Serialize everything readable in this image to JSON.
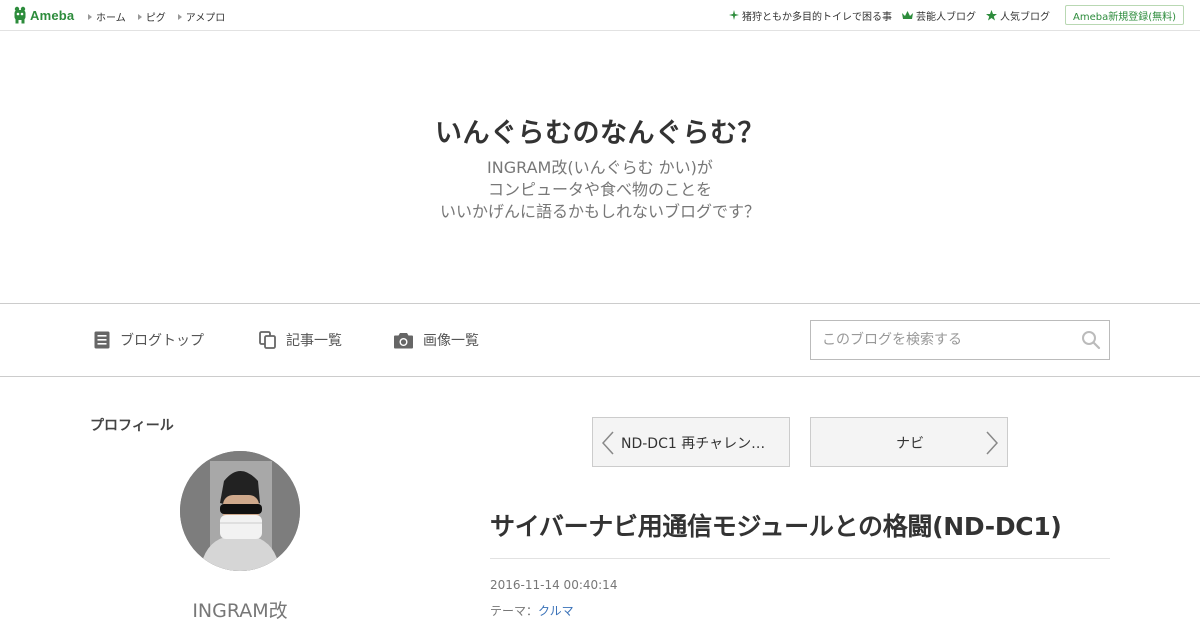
{
  "topbar": {
    "logo_text": "Ameba",
    "nav": [
      {
        "label": "ホーム"
      },
      {
        "label": "ピグ"
      },
      {
        "label": "アメプロ"
      }
    ],
    "right_links": [
      {
        "label": "猪狩ともか多目的トイレで困る事",
        "icon": "sparkle-icon"
      },
      {
        "label": "芸能人ブログ",
        "icon": "crown-icon"
      },
      {
        "label": "人気ブログ",
        "icon": "star-icon"
      }
    ],
    "register_label": "Ameba新規登録(無料)"
  },
  "header": {
    "title": "いんぐらむのなんぐらむ？",
    "description": [
      "INGRAM改(いんぐらむ かい)が",
      "コンピュータや食べ物のことを",
      "いいかげんに語るかもしれないブログです？"
    ]
  },
  "navbar": {
    "items": [
      {
        "label": "ブログトップ",
        "icon": "document-icon"
      },
      {
        "label": "記事一覧",
        "icon": "copy-icon"
      },
      {
        "label": "画像一覧",
        "icon": "camera-icon"
      }
    ],
    "search_placeholder": "このブログを検索する"
  },
  "sidebar": {
    "heading": "プロフィール",
    "profile_name": "INGRAM改"
  },
  "article": {
    "prev_label": "ND-DC1 再チャレン…",
    "next_label": "ナビ",
    "title": "サイバーナビ用通信モジュールとの格闘(ND-DC1)",
    "date": "2016-11-14 00:40:14",
    "theme_prefix": "テーマ：",
    "theme": "クルマ"
  },
  "colors": {
    "brand_green": "#2d8c3c",
    "link_blue": "#3a72b8"
  }
}
